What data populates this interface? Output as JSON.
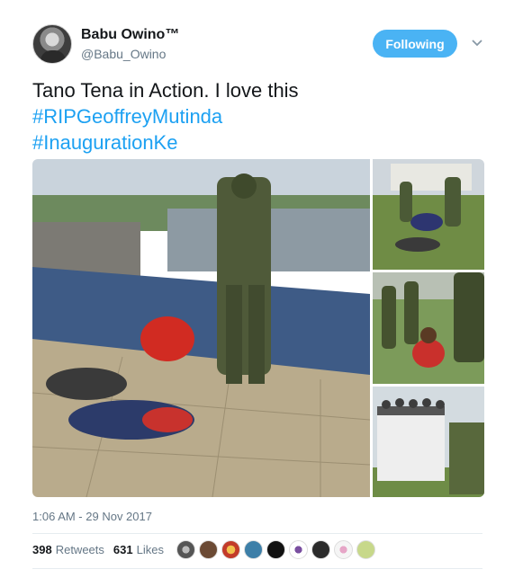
{
  "author": {
    "display_name": "Babu Owino™",
    "handle": "@Babu_Owino"
  },
  "follow_button": {
    "label": "Following",
    "color": "#4ab3f4"
  },
  "more_icon": "chevron-down-icon",
  "tweet": {
    "line1": "Tano Tena in Action. I love this",
    "hashtag1": "#RIPGeoffreyMutinda",
    "hashtag2": "#InaugurationKe",
    "hashtag_color": "#1da1f2"
  },
  "timestamp": "1:06 AM - 29 Nov 2017",
  "stats": {
    "retweets_count": "398",
    "retweets_label": "Retweets",
    "likes_count": "631",
    "likes_label": "Likes"
  },
  "likers_count_shown": 10
}
